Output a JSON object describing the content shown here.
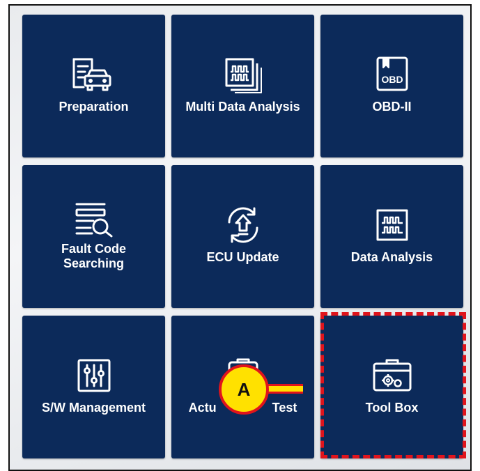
{
  "tiles": [
    {
      "id": "preparation",
      "label": "Preparation",
      "icon": "document-car-icon"
    },
    {
      "id": "multi-data-analysis",
      "label": "Multi Data Analysis",
      "icon": "stacked-waveform-icon"
    },
    {
      "id": "obd2",
      "label": "OBD-II",
      "icon": "obd-book-icon",
      "icon_text": "OBD"
    },
    {
      "id": "fault-code-searching",
      "label_line1": "Fault Code",
      "label_line2": "Searching",
      "icon": "list-search-icon"
    },
    {
      "id": "ecu-update",
      "label": "ECU Update",
      "icon": "update-cycle-icon"
    },
    {
      "id": "data-analysis",
      "label": "Data Analysis",
      "icon": "waveform-icon"
    },
    {
      "id": "sw-management",
      "label": "S/W Management",
      "icon": "sliders-icon"
    },
    {
      "id": "actuation-test",
      "label_left": "Actu",
      "label_right": "Test",
      "icon": "actuator-icon"
    },
    {
      "id": "tool-box",
      "label": "Tool Box",
      "icon": "toolbox-gears-icon"
    }
  ],
  "callout": {
    "letter": "A"
  },
  "colors": {
    "tile_bg": "#0c2a5a",
    "highlight": "#e0141c",
    "callout_fill": "#ffe100"
  }
}
